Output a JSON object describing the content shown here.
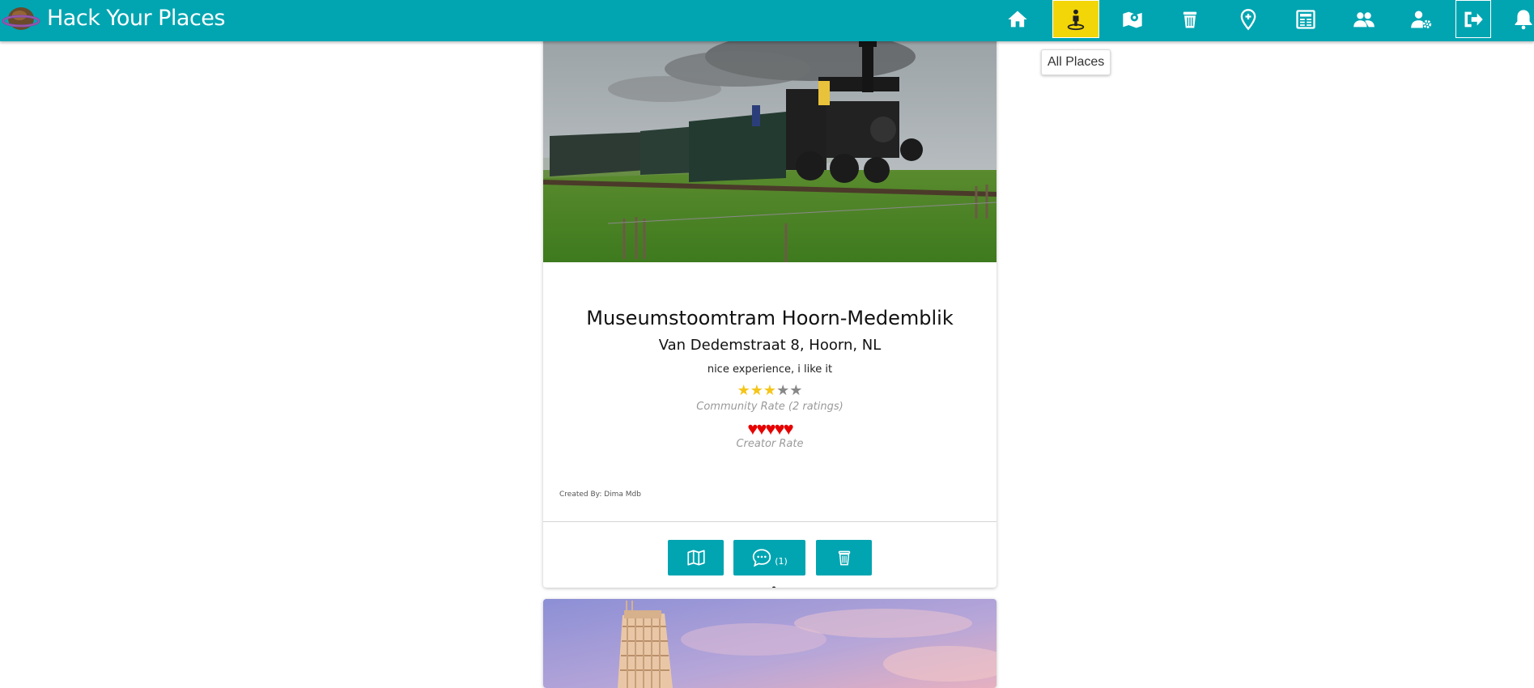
{
  "app": {
    "title": "Hack Your Places",
    "accent_color": "#00a5b1",
    "active_color": "#f2d608"
  },
  "nav": {
    "items": [
      {
        "icon": "home-icon"
      },
      {
        "icon": "person-pin-icon",
        "active": true
      },
      {
        "icon": "map-pin-icon"
      },
      {
        "icon": "trash-can-icon"
      },
      {
        "icon": "add-location-icon"
      },
      {
        "icon": "newspaper-icon"
      },
      {
        "icon": "users-icon"
      },
      {
        "icon": "user-settings-icon"
      },
      {
        "icon": "logout-icon"
      },
      {
        "icon": "bell-icon"
      }
    ]
  },
  "dropdown": {
    "label": "All Places"
  },
  "place": {
    "name": "Museumstoomtram Hoorn-Medemblik",
    "address": "Van Dedemstraat 8, Hoorn, NL",
    "description": "nice experience, i like it",
    "community_rating": 3,
    "community_max": 5,
    "community_label": "Community Rate (2 ratings)",
    "creator_rating": 5,
    "creator_max": 5,
    "creator_label": "Creator Rate",
    "created_by": "Created By: Dima Mdb",
    "comment_count": "(1)",
    "image": "steam-train-photo"
  },
  "next_place": {
    "image": "leaning-tower-photo"
  },
  "colors": {
    "star_on": "#f5c518",
    "star_off": "#888888",
    "heart": "#e60000"
  }
}
